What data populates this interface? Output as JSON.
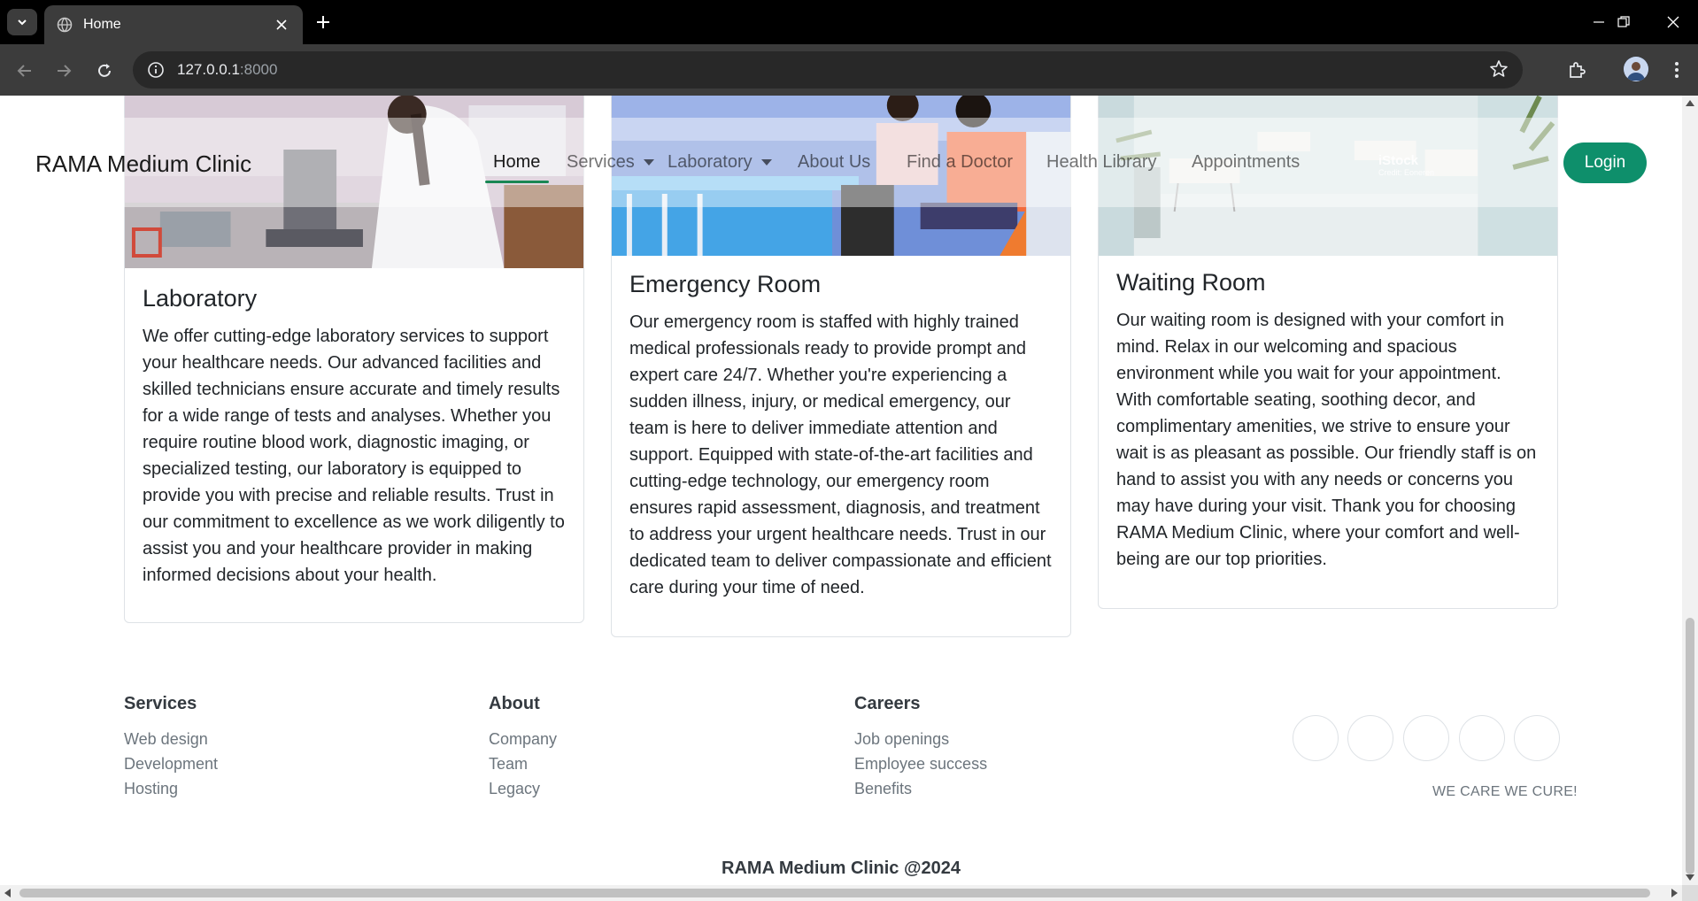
{
  "browser": {
    "tab_title": "Home",
    "url_host": "127.0.0.1",
    "url_port": ":8000"
  },
  "navbar": {
    "brand": "RAMA Medium Clinic",
    "links": [
      {
        "label": "Home",
        "active": true
      },
      {
        "label": "Services",
        "dropdown": true
      },
      {
        "label": "Laboratory",
        "dropdown": true
      },
      {
        "label": "About Us"
      },
      {
        "label": "Find a Doctor"
      },
      {
        "label": "Health Library"
      },
      {
        "label": "Appointments"
      }
    ],
    "login_label": "Login",
    "accent_color": "#198754",
    "login_color": "#0e8f6b"
  },
  "cards": [
    {
      "title": "Laboratory",
      "text": "We offer cutting-edge laboratory services to support your healthcare needs. Our advanced facilities and skilled technicians ensure accurate and timely results for a wide range of tests and analyses. Whether you require routine blood work, diagnostic imaging, or specialized testing, our laboratory is equipped to provide you with precise and reliable results. Trust in our commitment to excellence as we work diligently to assist you and your healthcare provider in making informed decisions about your health."
    },
    {
      "title": "Emergency Room",
      "text": "Our emergency room is staffed with highly trained medical professionals ready to provide prompt and expert care 24/7. Whether you're experiencing a sudden illness, injury, or medical emergency, our team is here to deliver immediate attention and support. Equipped with state-of-the-art facilities and cutting-edge technology, our emergency room ensures rapid assessment, diagnosis, and treatment to address your urgent healthcare needs. Trust in our dedicated team to deliver compassionate and efficient care during your time of need."
    },
    {
      "title": "Waiting Room",
      "text": "Our waiting room is designed with your comfort in mind. Relax in our welcoming and spacious environment while you wait for your appointment. With comfortable seating, soothing decor, and complimentary amenities, we strive to ensure your wait is as pleasant as possible. Our friendly staff is on hand to assist you with any needs or concerns you may have during your visit. Thank you for choosing RAMA Medium Clinic, where your comfort and well-being are our top priorities.",
      "image_watermark": "iStock",
      "image_credit": "Credit: Eoneren"
    }
  ],
  "footer": {
    "columns": [
      {
        "heading": "Services",
        "links": [
          "Web design",
          "Development",
          "Hosting"
        ]
      },
      {
        "heading": "About",
        "links": [
          "Company",
          "Team",
          "Legacy"
        ]
      },
      {
        "heading": "Careers",
        "links": [
          "Job openings",
          "Employee success",
          "Benefits"
        ]
      }
    ],
    "tagline": "WE CARE WE CURE!",
    "copyright": "RAMA Medium Clinic @2024"
  }
}
